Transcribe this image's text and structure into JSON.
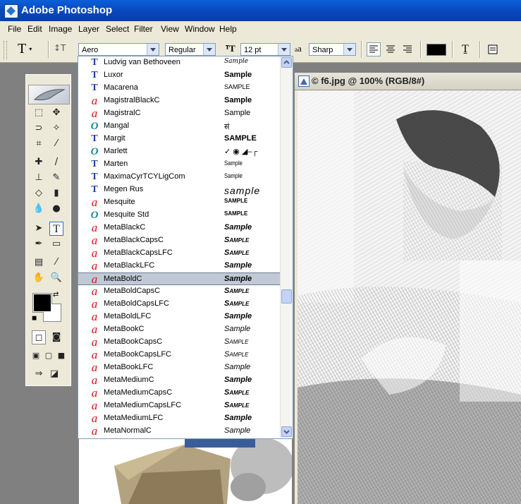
{
  "app": {
    "title": "Adobe Photoshop"
  },
  "menu": [
    "File",
    "Edit",
    "Image",
    "Layer",
    "Select",
    "Filter",
    "View",
    "Window",
    "Help"
  ],
  "options": {
    "tool_glyph": "T",
    "font_family": "Aero",
    "font_style": "Regular",
    "font_size": "12 pt",
    "aa_label": "a",
    "aa_sub": "a",
    "antialias": "Sharp",
    "color": "#000000"
  },
  "document": {
    "title": "© f6.jpg @ 100% (RGB/8#)"
  },
  "font_list": {
    "sample_text": "Sample",
    "selected_index": 17,
    "items": [
      {
        "name": "Ludvig van Bethoveen",
        "type": "tt",
        "sample": "Sample",
        "style": "script"
      },
      {
        "name": "Luxor",
        "type": "tt",
        "sample": "Sample",
        "style": "bold"
      },
      {
        "name": "Macarena",
        "type": "tt",
        "sample": "SAMPLE",
        "style": "outline"
      },
      {
        "name": "MagistralBlackC",
        "type": "ot",
        "sample": "Sample",
        "style": "bold"
      },
      {
        "name": "MagistralC",
        "type": "ot",
        "sample": "Sample",
        "style": "plain"
      },
      {
        "name": "Mangal",
        "type": "op",
        "sample": "सं",
        "style": "plain"
      },
      {
        "name": "Margit",
        "type": "tt",
        "sample": "SAMPLE",
        "style": "bold"
      },
      {
        "name": "Marlett",
        "type": "op",
        "sample": "✓ ◉ ◢–┌",
        "style": "plain"
      },
      {
        "name": "Marten",
        "type": "tt",
        "sample": "Sample",
        "style": "condensed"
      },
      {
        "name": "MaximaCyrTCYLigCom",
        "type": "tt",
        "sample": "Sample",
        "style": "condensed"
      },
      {
        "name": "Megen Rus",
        "type": "tt",
        "sample": "sample",
        "style": "wide"
      },
      {
        "name": "Mesquite",
        "type": "ot",
        "sample": "SAMPLE",
        "style": "tiny"
      },
      {
        "name": "Mesquite Std",
        "type": "op",
        "sample": "SAMPLE",
        "style": "tiny"
      },
      {
        "name": "MetaBlackC",
        "type": "ot",
        "sample": "Sample",
        "style": "bolditalic"
      },
      {
        "name": "MetaBlackCapsC",
        "type": "ot",
        "sample": "Sample",
        "style": "bolditaliccaps"
      },
      {
        "name": "MetaBlackCapsLFC",
        "type": "ot",
        "sample": "Sample",
        "style": "bolditaliccaps"
      },
      {
        "name": "MetaBlackLFC",
        "type": "ot",
        "sample": "Sample",
        "style": "bolditalic"
      },
      {
        "name": "MetaBoldC",
        "type": "ot",
        "sample": "Sample",
        "style": "bolditalic"
      },
      {
        "name": "MetaBoldCapsC",
        "type": "ot",
        "sample": "Sample",
        "style": "bolditaliccaps"
      },
      {
        "name": "MetaBoldCapsLFC",
        "type": "ot",
        "sample": "Sample",
        "style": "bolditaliccaps"
      },
      {
        "name": "MetaBoldLFC",
        "type": "ot",
        "sample": "Sample",
        "style": "bolditalic"
      },
      {
        "name": "MetaBookC",
        "type": "ot",
        "sample": "Sample",
        "style": "italic"
      },
      {
        "name": "MetaBookCapsC",
        "type": "ot",
        "sample": "Sample",
        "style": "italiccaps"
      },
      {
        "name": "MetaBookCapsLFC",
        "type": "ot",
        "sample": "Sample",
        "style": "italiccaps"
      },
      {
        "name": "MetaBookLFC",
        "type": "ot",
        "sample": "Sample",
        "style": "italic"
      },
      {
        "name": "MetaMediumC",
        "type": "ot",
        "sample": "Sample",
        "style": "semibolditalic"
      },
      {
        "name": "MetaMediumCapsC",
        "type": "ot",
        "sample": "Sample",
        "style": "bolditaliccaps"
      },
      {
        "name": "MetaMediumCapsLFC",
        "type": "ot",
        "sample": "Sample",
        "style": "bolditaliccaps"
      },
      {
        "name": "MetaMediumLFC",
        "type": "ot",
        "sample": "Sample",
        "style": "semibolditalic"
      },
      {
        "name": "MetaNormalC",
        "type": "ot",
        "sample": "Sample",
        "style": "italic"
      }
    ]
  }
}
